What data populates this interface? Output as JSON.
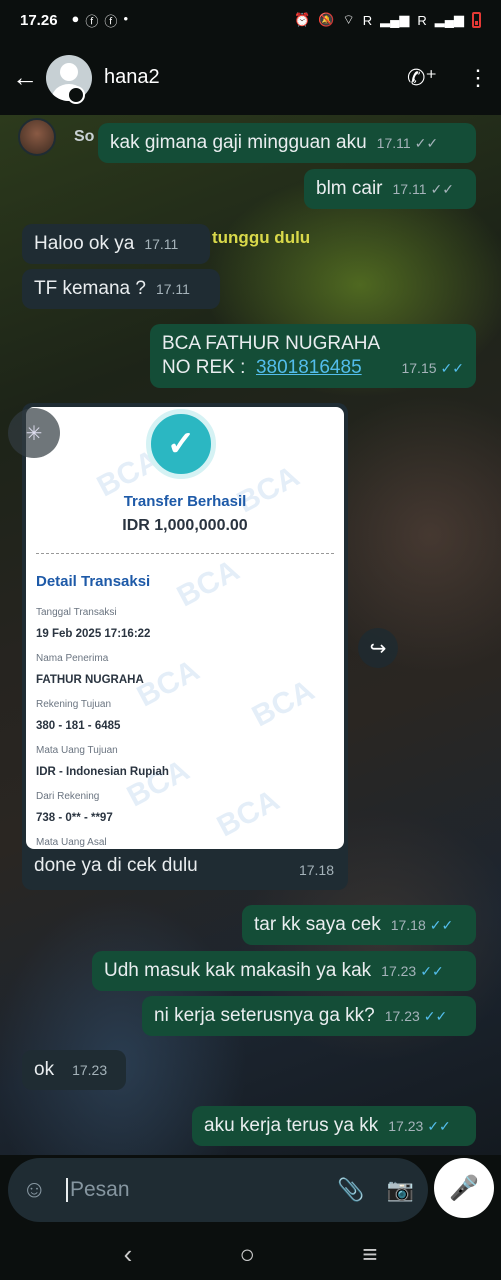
{
  "status_bar": {
    "time": "17.26",
    "signal_1": "R",
    "signal_2": "R"
  },
  "header": {
    "contact_name": "hana2",
    "back_icon": "arrow-left-icon",
    "call_icon": "add-call-icon",
    "menu_icon": "more-vert-icon"
  },
  "background": {
    "story_label": "So",
    "overlay_text": "tunggu dulu"
  },
  "messages": [
    {
      "text": "kak gimana gaji mingguan aku",
      "time": "17.11",
      "dir": "out",
      "ticks": "grey"
    },
    {
      "text": "blm cair",
      "time": "17.11",
      "dir": "out",
      "ticks": "grey"
    },
    {
      "text": "Haloo ok ya",
      "time": "17.11",
      "dir": "in"
    },
    {
      "text": "TF kemana ?",
      "time": "17.11",
      "dir": "in"
    },
    {
      "line1": "BCA  FATHUR NUGRAHA",
      "line2_prefix": "NO REK :  ",
      "link": "3801816485",
      "time": "17.15",
      "dir": "out",
      "ticks": "blue"
    },
    {
      "text": "tar kk saya cek",
      "time": "17.18",
      "dir": "out",
      "ticks": "blue"
    },
    {
      "text": "Udh masuk kak makasih ya kak",
      "time": "17.23",
      "dir": "out",
      "ticks": "blue"
    },
    {
      "text": "ni kerja seterusnya ga kk?",
      "time": "17.23",
      "dir": "out",
      "ticks": "blue"
    },
    {
      "text": "ok",
      "time": "17.23",
      "dir": "in"
    },
    {
      "text": "aku kerja terus ya kk",
      "time": "17.23",
      "dir": "out",
      "ticks": "blue"
    }
  ],
  "image_message": {
    "caption": "done ya di cek dulu",
    "time": "17.18",
    "receipt": {
      "title": "Transfer Berhasil",
      "amount": "IDR 1,000,000.00",
      "section": "Detail Transaksi",
      "watermark": "BCA",
      "fields": [
        {
          "label": "Tanggal Transaksi",
          "value": "19 Feb 2025 17:16:22"
        },
        {
          "label": "Nama Penerima",
          "value": "FATHUR NUGRAHA"
        },
        {
          "label": "Rekening Tujuan",
          "value": "380 - 181 - 6485"
        },
        {
          "label": "Mata Uang Tujuan",
          "value": "IDR - Indonesian Rupiah"
        },
        {
          "label": "Dari Rekening",
          "value": "738 - 0** - **97"
        },
        {
          "label": "Mata Uang Asal",
          "value": ""
        }
      ]
    }
  },
  "composer": {
    "placeholder": "Pesan",
    "emoji_icon": "sticker-icon",
    "attach_icon": "paperclip-icon",
    "camera_icon": "camera-icon",
    "mic_icon": "microphone-icon"
  },
  "colors": {
    "outgoing_bubble": "#144d37",
    "incoming_bubble": "#1f2c33",
    "read_ticks": "#53bdeb",
    "link": "#53bdeb"
  }
}
